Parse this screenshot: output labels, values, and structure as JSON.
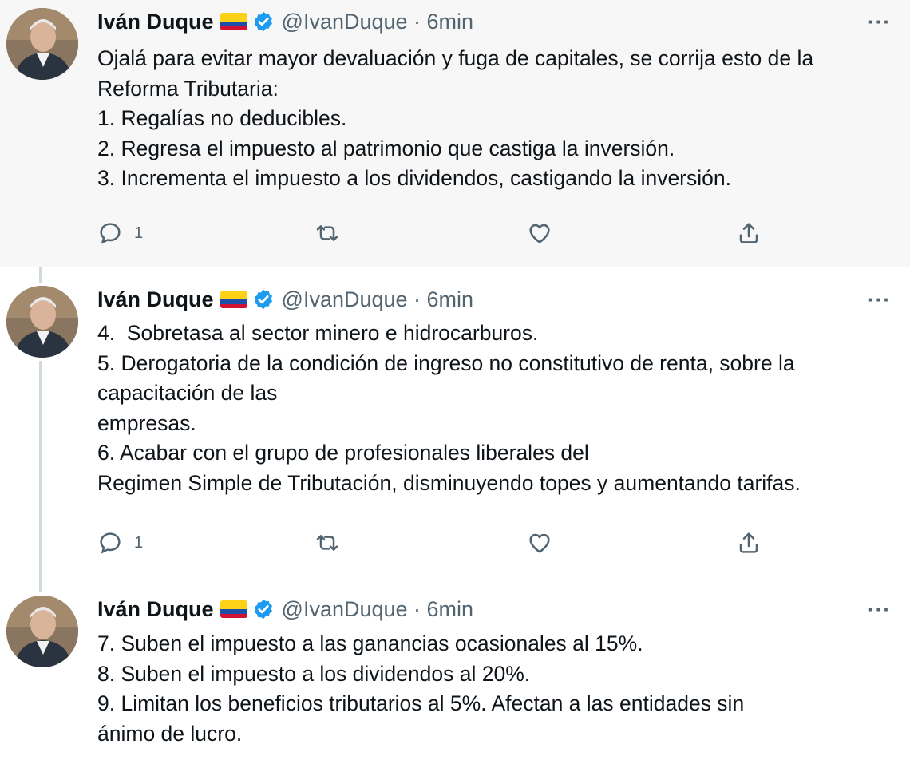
{
  "tweets": [
    {
      "author_name": "Iván Duque",
      "handle_time": "@IvanDuque · 6min",
      "more_label": "···",
      "lines": [
        "Ojalá para evitar mayor devaluación y fuga de capitales, se corrija esto de la",
        "Reforma Tributaria:",
        "1. Regalías no deducibles.",
        "2. Regresa el impuesto al patrimonio que castiga la inversión.",
        "3. Incrementa el impuesto a los dividendos, castigando la inversión."
      ],
      "reply_count": "1",
      "icons": [
        "reply-icon",
        "retweet-icon",
        "like-icon",
        "share-icon"
      ]
    },
    {
      "author_name": "Iván Duque",
      "handle_time": "@IvanDuque · 6min",
      "more_label": "···",
      "lines": [
        "4.  Sobretasa al sector minero e hidrocarburos.",
        "5. Derogatoria de la condición de ingreso no constitutivo de renta, sobre la",
        "capacitación de las",
        "empresas.",
        "6. Acabar con el grupo de profesionales liberales del",
        "Regimen Simple de Tributación, disminuyendo topes y aumentando tarifas."
      ],
      "reply_count": "1",
      "icons": [
        "reply-icon",
        "retweet-icon",
        "like-icon",
        "share-icon"
      ]
    },
    {
      "author_name": "Iván Duque",
      "handle_time": "@IvanDuque · 6min",
      "more_label": "···",
      "lines": [
        "7. Suben el impuesto a las ganancias ocasionales al 15%.",
        "8. Suben el impuesto a los dividendos al 20%.",
        "9. Limitan los beneficios tributarios al 5%. Afectan a las entidades sin",
        "ánimo de lucro."
      ]
    }
  ],
  "colors": {
    "highlight_bg": "#f7f7f7",
    "verified_blue": "#1d9bf0",
    "secondary_text": "#536471",
    "thread_line": "#cfd9de"
  }
}
